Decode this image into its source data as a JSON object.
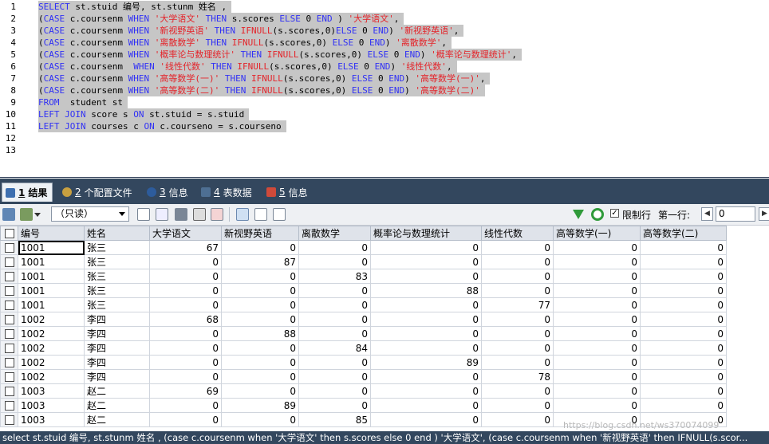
{
  "editor": {
    "line_numbers": [
      "1",
      "2",
      "3",
      "4",
      "5",
      "6",
      "7",
      "8",
      "9",
      "10",
      "11",
      "12",
      "13"
    ],
    "lines": [
      [
        [
          "kw",
          "SELECT"
        ],
        [
          "id",
          " st.stuid 编号, st.stunm 姓名 ,"
        ]
      ],
      [
        [
          "id",
          "("
        ],
        [
          "kw",
          "CASE"
        ],
        [
          "id",
          " c.coursenm "
        ],
        [
          "kw",
          "WHEN"
        ],
        [
          "id",
          " "
        ],
        [
          "str",
          "'大学语文'"
        ],
        [
          "id",
          " "
        ],
        [
          "kw",
          "THEN"
        ],
        [
          "id",
          " s.scores "
        ],
        [
          "kw",
          "ELSE"
        ],
        [
          "id",
          " 0 "
        ],
        [
          "kw",
          "END"
        ],
        [
          "id",
          " ) "
        ],
        [
          "str",
          "'大学语文'"
        ],
        [
          "id",
          ","
        ]
      ],
      [
        [
          "id",
          "("
        ],
        [
          "kw",
          "CASE"
        ],
        [
          "id",
          " c.coursenm "
        ],
        [
          "kw",
          "WHEN"
        ],
        [
          "id",
          " "
        ],
        [
          "str",
          "'新视野英语'"
        ],
        [
          "id",
          " "
        ],
        [
          "kw",
          "THEN"
        ],
        [
          "id",
          " "
        ],
        [
          "fn",
          "IFNULL"
        ],
        [
          "id",
          "(s.scores,0)"
        ],
        [
          "kw",
          "ELSE"
        ],
        [
          "id",
          " 0 "
        ],
        [
          "kw",
          "END"
        ],
        [
          "id",
          ") "
        ],
        [
          "str",
          "'新视野英语'"
        ],
        [
          "id",
          ","
        ]
      ],
      [
        [
          "id",
          "("
        ],
        [
          "kw",
          "CASE"
        ],
        [
          "id",
          " c.coursenm "
        ],
        [
          "kw",
          "WHEN"
        ],
        [
          "id",
          " "
        ],
        [
          "str",
          "'离散数学'"
        ],
        [
          "id",
          " "
        ],
        [
          "kw",
          "THEN"
        ],
        [
          "id",
          " "
        ],
        [
          "fn",
          "IFNULL"
        ],
        [
          "id",
          "(s.scores,0) "
        ],
        [
          "kw",
          "ELSE"
        ],
        [
          "id",
          " 0 "
        ],
        [
          "kw",
          "END"
        ],
        [
          "id",
          ") "
        ],
        [
          "str",
          "'离散数学'"
        ],
        [
          "id",
          ","
        ]
      ],
      [
        [
          "id",
          "("
        ],
        [
          "kw",
          "CASE"
        ],
        [
          "id",
          " c.coursenm "
        ],
        [
          "kw",
          "WHEN"
        ],
        [
          "id",
          " "
        ],
        [
          "str",
          "'概率论与数理统计'"
        ],
        [
          "id",
          " "
        ],
        [
          "kw",
          "THEN"
        ],
        [
          "id",
          " "
        ],
        [
          "fn",
          "IFNULL"
        ],
        [
          "id",
          "(s.scores,0) "
        ],
        [
          "kw",
          "ELSE"
        ],
        [
          "id",
          " 0 "
        ],
        [
          "kw",
          "END"
        ],
        [
          "id",
          ") "
        ],
        [
          "str",
          "'概率论与数理统计'"
        ],
        [
          "id",
          ","
        ]
      ],
      [
        [
          "id",
          "("
        ],
        [
          "kw",
          "CASE"
        ],
        [
          "id",
          " c.coursenm  "
        ],
        [
          "kw",
          "WHEN"
        ],
        [
          "id",
          " "
        ],
        [
          "str",
          "'线性代数'"
        ],
        [
          "id",
          " "
        ],
        [
          "kw",
          "THEN"
        ],
        [
          "id",
          " "
        ],
        [
          "fn",
          "IFNULL"
        ],
        [
          "id",
          "(s.scores,0) "
        ],
        [
          "kw",
          "ELSE"
        ],
        [
          "id",
          " 0 "
        ],
        [
          "kw",
          "END"
        ],
        [
          "id",
          ") "
        ],
        [
          "str",
          "'线性代数'"
        ],
        [
          "id",
          ","
        ]
      ],
      [
        [
          "id",
          "("
        ],
        [
          "kw",
          "CASE"
        ],
        [
          "id",
          " c.coursenm "
        ],
        [
          "kw",
          "WHEN"
        ],
        [
          "id",
          " "
        ],
        [
          "str",
          "'高等数学(一)'"
        ],
        [
          "id",
          " "
        ],
        [
          "kw",
          "THEN"
        ],
        [
          "id",
          " "
        ],
        [
          "fn",
          "IFNULL"
        ],
        [
          "id",
          "(s.scores,0) "
        ],
        [
          "kw",
          "ELSE"
        ],
        [
          "id",
          " 0 "
        ],
        [
          "kw",
          "END"
        ],
        [
          "id",
          ") "
        ],
        [
          "str",
          "'高等数学(一)'"
        ],
        [
          "id",
          ","
        ]
      ],
      [
        [
          "id",
          "("
        ],
        [
          "kw",
          "CASE"
        ],
        [
          "id",
          " c.coursenm "
        ],
        [
          "kw",
          "WHEN"
        ],
        [
          "id",
          " "
        ],
        [
          "str",
          "'高等数学(二)'"
        ],
        [
          "id",
          " "
        ],
        [
          "kw",
          "THEN"
        ],
        [
          "id",
          " "
        ],
        [
          "fn",
          "IFNULL"
        ],
        [
          "id",
          "(s.scores,0) "
        ],
        [
          "kw",
          "ELSE"
        ],
        [
          "id",
          " 0 "
        ],
        [
          "kw",
          "END"
        ],
        [
          "id",
          ") "
        ],
        [
          "str",
          "'高等数学(二)'"
        ]
      ],
      [
        [
          "kw",
          "FROM"
        ],
        [
          "id",
          "  student st"
        ]
      ],
      [
        [
          "kw",
          "LEFT JOIN"
        ],
        [
          "id",
          " score s "
        ],
        [
          "kw",
          "ON"
        ],
        [
          "id",
          " st.stuid = s.stuid"
        ]
      ],
      [
        [
          "kw",
          "LEFT JOIN"
        ],
        [
          "id",
          " courses c "
        ],
        [
          "kw",
          "ON"
        ],
        [
          "id",
          " c.courseno = s.courseno"
        ]
      ],
      [],
      []
    ]
  },
  "tabs": [
    {
      "num": "1",
      "label": "结果",
      "color": "#3d6fb0"
    },
    {
      "num": "2",
      "label": "个配置文件",
      "color": "#c8a040"
    },
    {
      "num": "3",
      "label": "信息",
      "color": "#2d5c9c"
    },
    {
      "num": "4",
      "label": "表数据",
      "color": "#4e6f93"
    },
    {
      "num": "5",
      "label": "信息",
      "color": "#d04a3a"
    }
  ],
  "toolbar": {
    "mode": "（只读）",
    "limit_label": "限制行",
    "first_row_label": "第一行:",
    "first_row_value": "0",
    "limit_checked": "✓"
  },
  "grid": {
    "columns": [
      "编号",
      "姓名",
      "大学语文",
      "新视野英语",
      "离散数学",
      "概率论与数理统计",
      "线性代数",
      "高等数学(一)",
      "高等数学(二)"
    ],
    "rows": [
      [
        "1001",
        "张三",
        "67",
        "0",
        "0",
        "0",
        "0",
        "0",
        "0"
      ],
      [
        "1001",
        "张三",
        "0",
        "87",
        "0",
        "0",
        "0",
        "0",
        "0"
      ],
      [
        "1001",
        "张三",
        "0",
        "0",
        "83",
        "0",
        "0",
        "0",
        "0"
      ],
      [
        "1001",
        "张三",
        "0",
        "0",
        "0",
        "88",
        "0",
        "0",
        "0"
      ],
      [
        "1001",
        "张三",
        "0",
        "0",
        "0",
        "0",
        "77",
        "0",
        "0"
      ],
      [
        "1002",
        "李四",
        "68",
        "0",
        "0",
        "0",
        "0",
        "0",
        "0"
      ],
      [
        "1002",
        "李四",
        "0",
        "88",
        "0",
        "0",
        "0",
        "0",
        "0"
      ],
      [
        "1002",
        "李四",
        "0",
        "0",
        "84",
        "0",
        "0",
        "0",
        "0"
      ],
      [
        "1002",
        "李四",
        "0",
        "0",
        "0",
        "89",
        "0",
        "0",
        "0"
      ],
      [
        "1002",
        "李四",
        "0",
        "0",
        "0",
        "0",
        "78",
        "0",
        "0"
      ],
      [
        "1003",
        "赵二",
        "69",
        "0",
        "0",
        "0",
        "0",
        "0",
        "0"
      ],
      [
        "1003",
        "赵二",
        "0",
        "89",
        "0",
        "0",
        "0",
        "0",
        "0"
      ],
      [
        "1003",
        "赵二",
        "0",
        "0",
        "85",
        "0",
        "0",
        "0",
        "0"
      ]
    ]
  },
  "statusbar": {
    "text": "select st.stuid 编号, st.stunm 姓名 , (case c.coursenm when '大学语文' then s.scores else 0 end ) '大学语文', (case c.coursenm when '新视野英语' then IFNULL(s.scor..."
  },
  "watermark": "https://blog.csdn.net/ws370074099",
  "colors": {
    "keyword": "#3131f5",
    "string": "#e4242a",
    "selection": "#c6c6c6",
    "panel": "#33475e"
  }
}
